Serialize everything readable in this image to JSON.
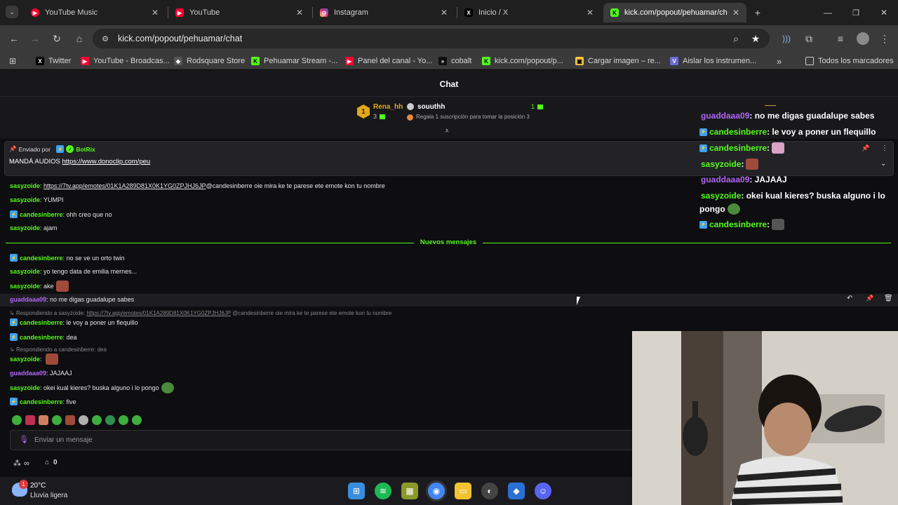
{
  "browser": {
    "tabs": [
      {
        "title": "YouTube Music",
        "icon": "youtube-music-icon",
        "color": "#ff0033"
      },
      {
        "title": "YouTube",
        "icon": "youtube-icon",
        "color": "#ff0033"
      },
      {
        "title": "Instagram",
        "icon": "instagram-icon",
        "color": "#d62976"
      },
      {
        "title": "Inicio / X",
        "icon": "x-icon",
        "color": "#000000"
      },
      {
        "title": "kick.com/popout/pehuamar/ch",
        "icon": "kick-icon",
        "color": "#53fc18"
      }
    ],
    "url": "kick.com/popout/pehuamar/chat",
    "bookmarks": [
      {
        "label": "Twitter",
        "icon": "x-icon"
      },
      {
        "label": "YouTube - Broadcas...",
        "icon": "youtube-icon"
      },
      {
        "label": "Rodsquare Store",
        "icon": "store-icon"
      },
      {
        "label": "Pehuamar Stream -...",
        "icon": "kick-icon"
      },
      {
        "label": "Panel del canal - Yo...",
        "icon": "youtube-icon"
      },
      {
        "label": "cobalt",
        "icon": "cobalt-icon"
      },
      {
        "label": "kick.com/popout/p...",
        "icon": "kick-icon"
      },
      {
        "label": "Cargar imagen – re...",
        "icon": "image-icon"
      },
      {
        "label": "Aislar los instrumen...",
        "icon": "v-icon"
      }
    ],
    "all_bookmarks": "Todos los marcadores"
  },
  "chat": {
    "title": "Chat",
    "leaderboard": {
      "rank": "1",
      "first_user": "Rena_hh",
      "first_count": "3",
      "second_user": "souuthh",
      "second_count": "1",
      "hint": "Regala 1 suscripción para tomar la posición 3"
    },
    "pinned": {
      "sent_by_label": "Enviado por",
      "sent_by_user": "BotRix",
      "text": "MANDÁ AUDIOS",
      "link": "https://www.donoclip.com/peu"
    },
    "messages_before": [
      {
        "user": "sasyzoide",
        "type": "s",
        "text": "",
        "link": "https://7tv.app/emotes/01K1A289D81X0K1YG0ZPJHJ6JP",
        "after": " @candesinberre oie mira ke te parese ete emote kon tu nombre"
      },
      {
        "user": "sasyzoide",
        "type": "s",
        "text": "YUMPI"
      },
      {
        "user": "candesinberre",
        "type": "c",
        "text": "ohh creo que no"
      },
      {
        "user": "sasyzoide",
        "type": "s",
        "text": "ajam"
      }
    ],
    "new_messages_label": "Nuevos mensajes",
    "messages_after": [
      {
        "user": "candesinberre",
        "type": "c",
        "text": "no se ve un orto twin"
      },
      {
        "user": "sasyzoide",
        "type": "s",
        "text": "yo tengo data de emilia mernes..."
      },
      {
        "user": "sasyzoide",
        "type": "s",
        "text": "ake"
      },
      {
        "user": "guaddaaa09",
        "type": "g",
        "text": "no me digas guadalupe sabes"
      }
    ],
    "reply1_label": "Respondiendo a sasyzoide:",
    "reply1_link": "https://7tv.app/emotes/01K1A289D81X0K1YG0ZPJHJ6JP",
    "reply1_rest": " @candesinberre oie mira ke te parese ete emote kon tu nombre",
    "msg_c1_user": "candesinberre",
    "msg_c1_text": "le voy a poner un flequillo",
    "msg_c2_user": "candesinberre",
    "msg_c2_text": "dea",
    "reply2_label": "Respondiendo a candesinberre: dea",
    "msg_s3_user": "sasyzoide",
    "msg_g2_user": "guaddaaa09",
    "msg_g2_text": "JAJAAJ",
    "msg_s4_user": "sasyzoide",
    "msg_s4_text": "okei kual kieres? buska alguno i lo pongo",
    "msg_c3_user": "candesinberre",
    "msg_c3_text": "five",
    "input_placeholder": "Enviar un mensaje",
    "footer_points": "∞",
    "footer_gift_count": "0"
  },
  "overlay": {
    "messages": [
      {
        "user": "guaddaaa09",
        "kind": "g",
        "text": ": no me digas guadalupe sabes"
      },
      {
        "user": "candesinberre",
        "kind": "c",
        "text": ": le voy a poner un flequillo"
      },
      {
        "user": "candesinberre",
        "kind": "c",
        "text": " :"
      },
      {
        "user": "sasyzoide",
        "kind": "s",
        "text": " :"
      },
      {
        "user": "guaddaaa09",
        "kind": "g",
        "text": ": JAJAAJ"
      },
      {
        "user": "sasyzoide",
        "kind": "s",
        "text": ": okei kual kieres? buska alguno i lo"
      },
      {
        "user": "",
        "kind": "",
        "text": "pongo"
      },
      {
        "user": "candesinberre",
        "kind": "c",
        "text": " :"
      }
    ]
  },
  "weather": {
    "temp": "20°C",
    "desc": "Lluvia ligera",
    "alert": "1"
  },
  "colors": {
    "kick_green": "#53fc18",
    "purple_user": "#b067f5",
    "bg": "#0e0e10"
  }
}
